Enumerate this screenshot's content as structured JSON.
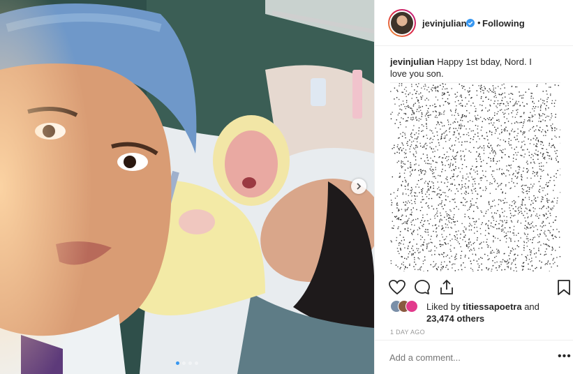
{
  "post": {
    "photo_alt": "Selfie with newborn baby in hospital",
    "carousel": {
      "next_icon": "chevron-right-icon",
      "dot_count": 4,
      "active_index": 0
    }
  },
  "header": {
    "username": "jevinjulian",
    "verified_icon": "verified-badge-icon",
    "separator": "•",
    "follow_status": "Following"
  },
  "caption": {
    "username": "jevinjulian",
    "text": "Happy 1st bday, Nord. I love you son."
  },
  "actions": {
    "like_icon": "heart-icon",
    "comment_icon": "comment-icon",
    "share_icon": "share-icon",
    "save_icon": "bookmark-icon"
  },
  "likes": {
    "prefix": "Liked by ",
    "user": "titiessapoetra",
    "middle": " and",
    "count": "23,474 others"
  },
  "timestamp": "1 DAY AGO",
  "comment": {
    "placeholder": "Add a comment...",
    "more_label": "•••"
  },
  "colors": {
    "accent": "#3897f0",
    "text": "#262626",
    "muted": "#999999",
    "border": "#efefef"
  }
}
